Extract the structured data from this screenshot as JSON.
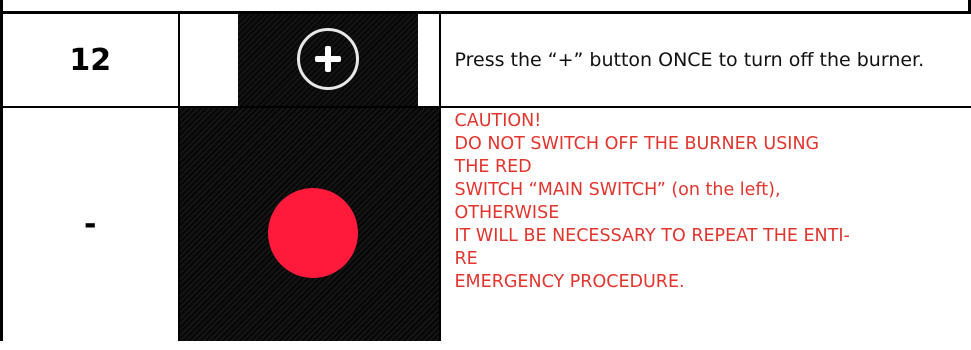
{
  "rows": [
    {
      "step": "12",
      "icon": "plus-button-icon",
      "text": "Press the “+” button ONCE to turn off the burner."
    },
    {
      "step": "-",
      "icon": "red-main-switch-icon",
      "caution_lines": [
        "CAUTION!",
        "DO NOT SWITCH OFF THE BURNER USING",
        "THE RED",
        "SWITCH “MAIN SWITCH” (on the left),",
        "OTHERWISE",
        "IT WILL BE NECESSARY TO REPEAT THE ENTI-",
        "RE",
        "EMERGENCY PROCEDURE."
      ]
    }
  ],
  "colors": {
    "caution": "#e2352e",
    "switch_red": "#ff1a3c",
    "panel_bg": "#0b0b0b"
  }
}
